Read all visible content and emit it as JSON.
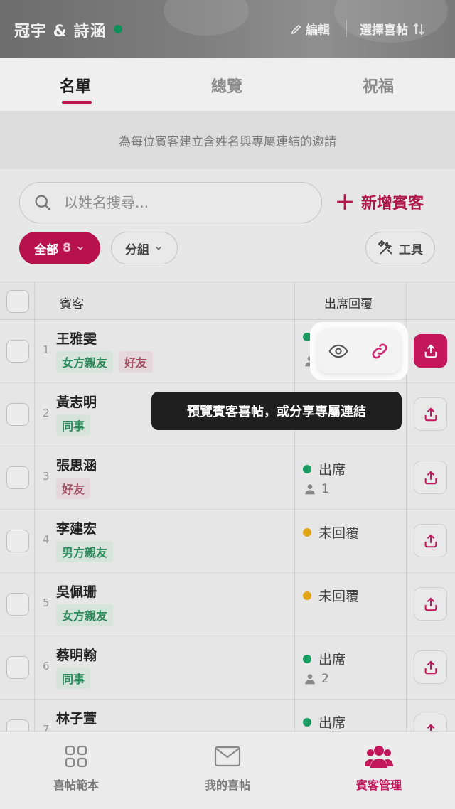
{
  "header": {
    "couple_name": "冠宇 & 詩涵",
    "edit_label": "編輯",
    "select_label": "選擇喜帖"
  },
  "tabs": [
    {
      "label": "名單",
      "active": true
    },
    {
      "label": "總覽",
      "active": false
    },
    {
      "label": "祝福",
      "active": false
    }
  ],
  "banner_text": "為每位賓客建立含姓名與專屬連結的邀請",
  "search": {
    "placeholder": "以姓名搜尋..."
  },
  "add_guest_label": "新增賓客",
  "filters": {
    "all_label": "全部",
    "all_count": "8",
    "group_label": "分組",
    "tools_label": "工具"
  },
  "table": {
    "col_guest": "賓客",
    "col_rsvp": "出席回覆",
    "rows": [
      {
        "num": "1",
        "name": "王雅雯",
        "tags": [
          {
            "text": "女方親友",
            "kind": "t1"
          },
          {
            "text": "好友",
            "kind": "t2"
          }
        ],
        "status": "",
        "party": "",
        "status_color": "#1a9c63"
      },
      {
        "num": "2",
        "name": "黃志明",
        "tags": [
          {
            "text": "同事",
            "kind": "t1"
          }
        ],
        "status": "",
        "party": "",
        "status_color": ""
      },
      {
        "num": "3",
        "name": "張思涵",
        "tags": [
          {
            "text": "好友",
            "kind": "t2"
          }
        ],
        "status": "出席",
        "party": "1",
        "status_color": "#1a9c63"
      },
      {
        "num": "4",
        "name": "李建宏",
        "tags": [
          {
            "text": "男方親友",
            "kind": "t1"
          }
        ],
        "status": "未回覆",
        "party": "",
        "status_color": "#e0a416"
      },
      {
        "num": "5",
        "name": "吳佩珊",
        "tags": [
          {
            "text": "女方親友",
            "kind": "t1"
          }
        ],
        "status": "未回覆",
        "party": "",
        "status_color": "#e0a416"
      },
      {
        "num": "6",
        "name": "蔡明翰",
        "tags": [
          {
            "text": "同事",
            "kind": "t1"
          }
        ],
        "status": "出席",
        "party": "2",
        "status_color": "#1a9c63"
      },
      {
        "num": "7",
        "name": "林子萱",
        "tags": [],
        "status": "出席",
        "party": "",
        "status_color": "#1a9c63"
      }
    ]
  },
  "tooltip": "預覽賓客喜帖，或分享專屬連結",
  "bottom_nav": [
    {
      "label": "喜帖範本",
      "icon": "grid-icon",
      "active": false
    },
    {
      "label": "我的喜帖",
      "icon": "envelope-icon",
      "active": false
    },
    {
      "label": "賓客管理",
      "icon": "guests-icon",
      "active": true
    }
  ],
  "colors": {
    "accent": "#c2185b",
    "attending": "#1a9c63",
    "pending": "#e0a416"
  }
}
